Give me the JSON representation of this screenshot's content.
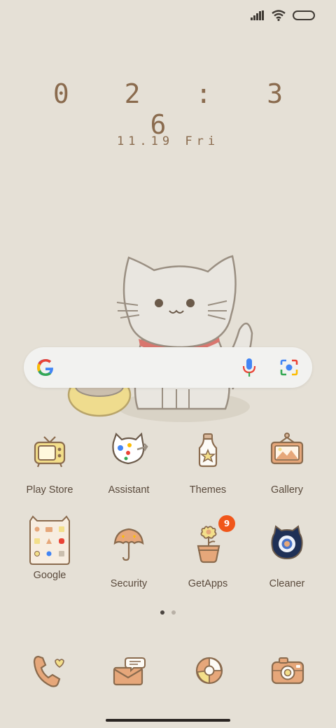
{
  "status_bar": {
    "icons": [
      "signal-icon",
      "wifi-icon",
      "battery-icon"
    ]
  },
  "clock": {
    "time": "0 2 : 3 6",
    "date": "11.19 Fri"
  },
  "search_bar": {
    "icons": [
      "google-logo",
      "microphone-icon",
      "lens-icon"
    ]
  },
  "apps": {
    "row1": [
      {
        "label": "Play Store"
      },
      {
        "label": "Assistant"
      },
      {
        "label": "Themes"
      },
      {
        "label": "Gallery"
      }
    ],
    "row2": [
      {
        "label": "Google"
      },
      {
        "label": "Security"
      },
      {
        "label": "GetApps",
        "badge": "9"
      },
      {
        "label": "Cleaner"
      }
    ]
  },
  "dock": {
    "icons": [
      "phone-icon",
      "messages-icon",
      "browser-icon",
      "camera-icon"
    ]
  },
  "page_indicator": {
    "pages": 2,
    "current": 1
  },
  "colors": {
    "background": "#e5e0d6",
    "accent": "#8a6b4e",
    "badge": "#f0561a"
  }
}
